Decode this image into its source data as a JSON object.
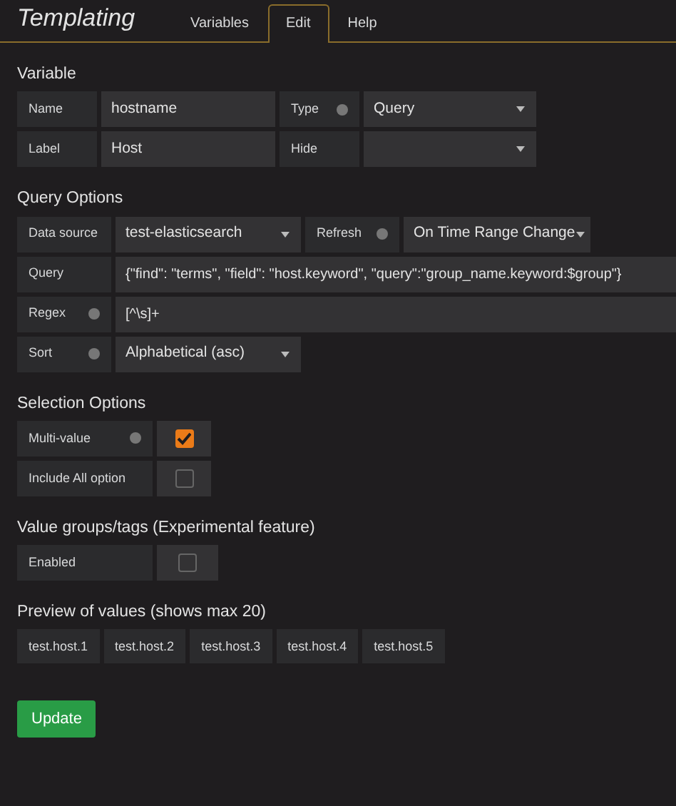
{
  "title": "Templating",
  "tabs": [
    {
      "label": "Variables",
      "selected": false
    },
    {
      "label": "Edit",
      "selected": true
    },
    {
      "label": "Help",
      "selected": false
    }
  ],
  "sections": [
    {
      "heading": "Variable",
      "rows": [
        [
          {
            "kind": "label",
            "text": "Name",
            "info": false
          },
          {
            "kind": "input",
            "value": "hostname"
          },
          {
            "kind": "label",
            "text": "Type",
            "info": true
          },
          {
            "kind": "select",
            "value": "Query"
          }
        ],
        [
          {
            "kind": "label",
            "text": "Label",
            "info": false
          },
          {
            "kind": "input",
            "value": "Host"
          },
          {
            "kind": "label",
            "text": "Hide",
            "info": false
          },
          {
            "kind": "select"
          }
        ]
      ]
    },
    {
      "heading": "Query Options",
      "rows": [
        [
          {
            "kind": "label",
            "text": "Data source",
            "info": false
          },
          {
            "kind": "select",
            "value": "test-elasticsearch"
          },
          {
            "kind": "label",
            "text": "Refresh",
            "info": true
          },
          {
            "kind": "select",
            "value": "On Time Range Change"
          }
        ],
        [
          {
            "kind": "label",
            "text": "Query",
            "info": false
          },
          {
            "kind": "input",
            "value": "{\"find\": \"terms\", \"field\": \"host.keyword\", \"query\":\"group_name.keyword:$group\"}"
          }
        ],
        [
          {
            "kind": "label",
            "text": "Regex",
            "info": true
          },
          {
            "kind": "input",
            "value": "[^\\s]+"
          }
        ],
        [
          {
            "kind": "label",
            "text": "Sort",
            "info": true
          },
          {
            "kind": "select",
            "value": "Alphabetical (asc)"
          }
        ]
      ]
    },
    {
      "heading": "Selection Options",
      "rows": [
        [
          {
            "kind": "label",
            "text": "Multi-value",
            "info": true
          },
          {
            "kind": "checkbox",
            "checked": true
          }
        ],
        [
          {
            "kind": "label",
            "text": "Include All option",
            "info": false
          },
          {
            "kind": "checkbox",
            "checked": false
          }
        ]
      ]
    },
    {
      "heading": "Value groups/tags (Experimental feature)",
      "rows": [
        [
          {
            "kind": "label",
            "text": "Enabled",
            "info": false
          },
          {
            "kind": "checkbox",
            "checked": false
          }
        ]
      ]
    }
  ],
  "preview": {
    "heading": "Preview of values (shows max 20)",
    "values": [
      "test.host.1",
      "test.host.2",
      "test.host.3",
      "test.host.4",
      "test.host.5"
    ]
  },
  "button": "Update"
}
